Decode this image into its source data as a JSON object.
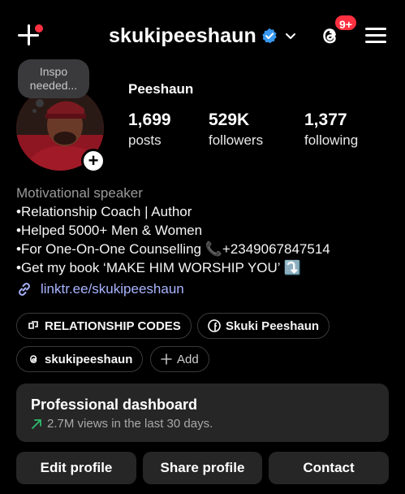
{
  "header": {
    "username": "skukipeeshaun",
    "notification_count": "9+"
  },
  "note": {
    "text": "Inspo needed..."
  },
  "profile": {
    "display_name": "Peeshaun",
    "stats": [
      {
        "value": "1,699",
        "label": "posts"
      },
      {
        "value": "529K",
        "label": "followers"
      },
      {
        "value": "1,377",
        "label": "following"
      }
    ]
  },
  "bio": {
    "category": "Motivational speaker",
    "lines": [
      "•Relationship Coach | Author",
      "•Helped 5000+ Men & Women",
      "•For One-On-One Counselling 📞+2349067847514",
      "•Get my book ‘MAKE HIM WORSHIP YOU’ ⤵️"
    ],
    "link": "linktr.ee/skukipeeshaun"
  },
  "chips": [
    {
      "label": "RELATIONSHIP CODES",
      "icon": "relationship-codes-icon"
    },
    {
      "label": "Skuki Peeshaun",
      "icon": "facebook-icon"
    },
    {
      "label": "skukipeeshaun",
      "icon": "threads-icon"
    },
    {
      "label": "Add",
      "icon": "plus-icon"
    }
  ],
  "dashboard": {
    "title": "Professional dashboard",
    "subtitle": "2.7M views in the last 30 days.",
    "trend_color": "#2dbd6e"
  },
  "buttons": {
    "edit": "Edit profile",
    "share": "Share profile",
    "contact": "Contact"
  },
  "colors": {
    "background": "#000000",
    "badge": "#ff3040",
    "verified": "#3897f0",
    "link": "#a9b4ff",
    "surface": "#262626"
  }
}
